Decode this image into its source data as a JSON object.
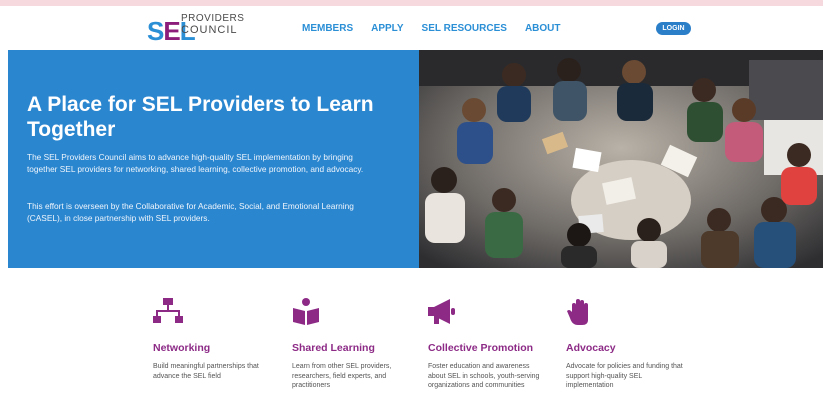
{
  "brand": {
    "logo_main": "SEL",
    "logo_top": "PROVIDERS",
    "logo_bottom": "COUNCIL",
    "colors": {
      "blue": "#2b8fd6",
      "purple": "#8c1d7a",
      "hero_bg": "#2b86d0"
    }
  },
  "nav": {
    "items": [
      {
        "label": "MEMBERS"
      },
      {
        "label": "APPLY"
      },
      {
        "label": "SEL RESOURCES"
      },
      {
        "label": "ABOUT"
      }
    ],
    "login_label": "LOGIN"
  },
  "hero": {
    "title": "A Place for SEL Providers to Learn Together",
    "paragraph1": "The SEL Providers Council aims to advance high-quality SEL implementation by bringing together SEL providers for networking, shared learning, collective promotion, and advocacy.",
    "paragraph2": "This effort is overseen by the Collaborative for Academic, Social, and Emotional Learning (CASEL), in close partnership with SEL providers.",
    "photo_icon": "students-group-photo"
  },
  "features": [
    {
      "icon": "network-icon",
      "title": "Networking",
      "description": "Build meaningful partnerships that advance the SEL field"
    },
    {
      "icon": "book-reader-icon",
      "title": "Shared Learning",
      "description": "Learn from other SEL providers, researchers, field experts, and practitioners"
    },
    {
      "icon": "megaphone-icon",
      "title": "Collective Promotion",
      "description": "Foster education and awareness about SEL in schools, youth-serving organizations and communities"
    },
    {
      "icon": "raised-hand-icon",
      "title": "Advocacy",
      "description": "Advocate for policies and funding that support high-quality SEL implementation"
    }
  ]
}
